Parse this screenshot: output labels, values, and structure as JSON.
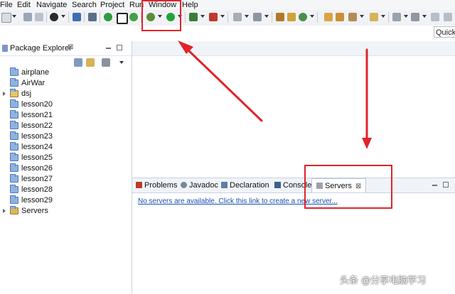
{
  "menubar": {
    "items": [
      {
        "label": "File"
      },
      {
        "label": "Edit"
      },
      {
        "label": "Navigate"
      },
      {
        "label": "Search"
      },
      {
        "label": "Project"
      },
      {
        "label": "Run"
      },
      {
        "label": "Window"
      },
      {
        "label": "Help"
      }
    ]
  },
  "toolbar": {
    "quick_access_placeholder": "Quick"
  },
  "package_explorer": {
    "title": "Package Explorer",
    "close_glyph": "⊠",
    "items": [
      {
        "label": "airplane"
      },
      {
        "label": "AirWar"
      },
      {
        "label": "dsj"
      },
      {
        "label": "lesson20"
      },
      {
        "label": "lesson21"
      },
      {
        "label": "lesson22"
      },
      {
        "label": "lesson23"
      },
      {
        "label": "lesson24"
      },
      {
        "label": "lesson25"
      },
      {
        "label": "lesson26"
      },
      {
        "label": "lesson27"
      },
      {
        "label": "lesson28"
      },
      {
        "label": "lesson29"
      },
      {
        "label": "Servers"
      }
    ]
  },
  "bottom_panel": {
    "tabs": [
      {
        "label": "Problems"
      },
      {
        "label": "Javadoc"
      },
      {
        "label": "Declaration"
      },
      {
        "label": "Console"
      },
      {
        "label": "Servers"
      }
    ],
    "servers_message": "No servers are available. Click this link to create a new server..."
  },
  "watermark": "头条 @分享电脑学习",
  "colors": {
    "highlight": "#e0242a",
    "link": "#1a4fb0"
  }
}
